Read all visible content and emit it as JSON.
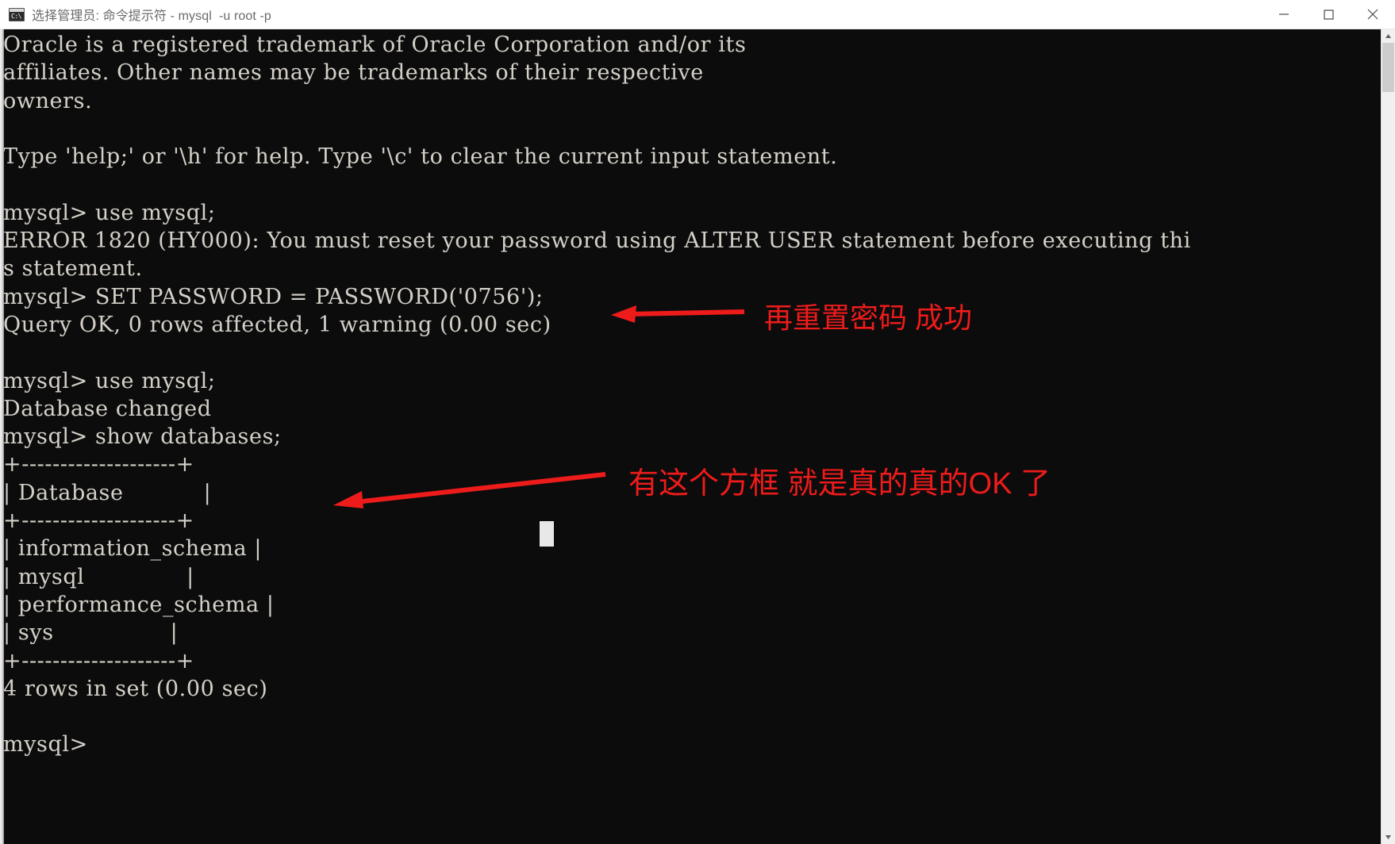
{
  "window": {
    "title": "选择管理员: 命令提示符 - mysql  -u root -p",
    "icon_name": "cmd-icon",
    "icon_glyph": "C:\\",
    "controls": {
      "minimize": "Minimize",
      "maximize": "Maximize",
      "close": "Close"
    }
  },
  "terminal": {
    "background_color": "#0c0c0c",
    "foreground_color": "#d4d0c8",
    "content": "Oracle is a registered trademark of Oracle Corporation and/or its\naffiliates. Other names may be trademarks of their respective\nowners.\n\nType 'help;' or '\\h' for help. Type '\\c' to clear the current input statement.\n\nmysql> use mysql;\nERROR 1820 (HY000): You must reset your password using ALTER USER statement before executing thi\ns statement.\nmysql> SET PASSWORD = PASSWORD('0756');\nQuery OK, 0 rows affected, 1 warning (0.00 sec)\n\nmysql> use mysql;\nDatabase changed\nmysql> show databases;\n+--------------------+\n| Database           |\n+--------------------+\n| information_schema |\n| mysql              |\n| performance_schema |\n| sys                |\n+--------------------+\n4 rows in set (0.00 sec)\n\nmysql>",
    "lines": [
      "Oracle is a registered trademark of Oracle Corporation and/or its",
      "affiliates. Other names may be trademarks of their respective",
      "owners.",
      "",
      "Type 'help;' or '\\h' for help. Type '\\c' to clear the current input statement.",
      "",
      "mysql> use mysql;",
      "ERROR 1820 (HY000): You must reset your password using ALTER USER statement before executing thi",
      "s statement.",
      "mysql> SET PASSWORD = PASSWORD('0756');",
      "Query OK, 0 rows affected, 1 warning (0.00 sec)",
      "",
      "mysql> use mysql;",
      "Database changed",
      "mysql> show databases;",
      "+--------------------+",
      "| Database           |",
      "+--------------------+",
      "| information_schema |",
      "| mysql              |",
      "| performance_schema |",
      "| sys                |",
      "+--------------------+",
      "4 rows in set (0.00 sec)",
      "",
      "mysql>"
    ],
    "result_table": {
      "header": "Database",
      "rows": [
        "information_schema",
        "mysql",
        "performance_schema",
        "sys"
      ],
      "footer": "4 rows in set (0.00 sec)"
    },
    "prompt": "mysql>",
    "cursor": "block-cursor"
  },
  "annotations": {
    "color": "#ee1b1b",
    "items": [
      {
        "label": "再重置密码 成功",
        "arrow": "left-arrow"
      },
      {
        "label": "有这个方框 就是真的真的OK 了",
        "arrow": "left-arrow"
      }
    ]
  },
  "scrollbar": {
    "up_glyph": "▲",
    "down_glyph": "▼"
  }
}
